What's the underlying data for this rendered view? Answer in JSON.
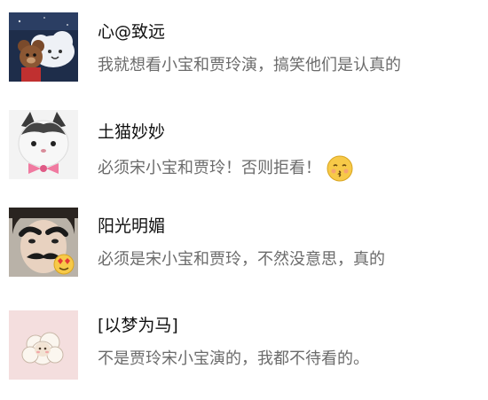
{
  "comments": [
    {
      "username": "心@致远",
      "text": "我就想看小宝和贾玲演，搞笑他们是认真的",
      "avatar_icon": "bear-cloud-avatar"
    },
    {
      "username": "土猫妙妙",
      "text": "必须宋小宝和贾玲！否则拒看！",
      "emoji_icon": "kiss-face-emoji",
      "avatar_icon": "cat-bowtie-avatar"
    },
    {
      "username": "阳光明媚",
      "text": "必须是宋小宝和贾玲，不然没意思，真的",
      "avatar_icon": "mustache-face-avatar"
    },
    {
      "username": "[以梦为马]",
      "text": "不是贾玲宋小宝演的，我都不待看的。",
      "avatar_icon": "sheep-avatar"
    }
  ],
  "colors": {
    "username": "#111111",
    "text": "#6b6b6b",
    "background": "#ffffff"
  }
}
